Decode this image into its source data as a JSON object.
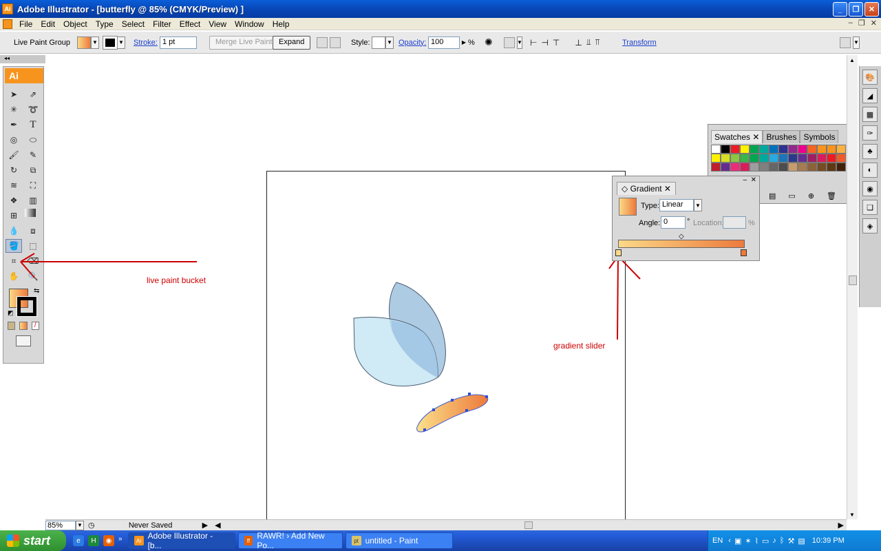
{
  "window": {
    "title": "Adobe Illustrator - [butterfly @ 85% (CMYK/Preview) ]",
    "app_icon": "Ai"
  },
  "menu": [
    "File",
    "Edit",
    "Object",
    "Type",
    "Select",
    "Filter",
    "Effect",
    "View",
    "Window",
    "Help"
  ],
  "control_bar": {
    "selection_label": "Live Paint Group",
    "stroke_label": "Stroke:",
    "stroke_value": "1 pt",
    "merge_button": "Merge Live Paint",
    "expand_button": "Expand",
    "style_label": "Style:",
    "opacity_label": "Opacity:",
    "opacity_value": "100",
    "opacity_unit": "%",
    "transform_link": "Transform"
  },
  "toolbox": {
    "logo": "Ai"
  },
  "swatches_panel": {
    "tabs": [
      "Swatches",
      "Brushes",
      "Symbols"
    ],
    "colors": [
      "#ffffff",
      "#000000",
      "#ed1c24",
      "#fff200",
      "#00a651",
      "#00a99d",
      "#0072bc",
      "#2e3192",
      "#92278f",
      "#ec008c",
      "#f26522",
      "#f7941d",
      "#f7941d",
      "#fbb040",
      "#fff200",
      "#d7df23",
      "#8dc63f",
      "#39b54a",
      "#00a651",
      "#00a99d",
      "#27aae1",
      "#1c75bc",
      "#2b388f",
      "#662d91",
      "#9e1f63",
      "#da1c5c",
      "#ed1c24",
      "#f15a29",
      "#be1e2d",
      "#662d91",
      "#ee2a7b",
      "#d91c5c",
      "#9e9e9e",
      "#808080",
      "#666666",
      "#4d4d4d",
      "#c69c6d",
      "#a67c52",
      "#8c6239",
      "#754c24",
      "#603813",
      "#42210b"
    ]
  },
  "gradient_panel": {
    "title": "Gradient",
    "type_label": "Type:",
    "type_value": "Linear",
    "angle_label": "Angle:",
    "angle_value": "0",
    "angle_unit": "°",
    "location_label": "Location:",
    "location_unit": "%",
    "start_color": "#fbd988",
    "end_color": "#ed7a3c"
  },
  "status": {
    "zoom": "85%",
    "save_state": "Never Saved"
  },
  "annotations": {
    "bucket": "live paint bucket",
    "slider": "gradient slider",
    "color": "#cc0000"
  },
  "taskbar": {
    "start": "start",
    "tasks": [
      {
        "label": "Adobe Illustrator - [b...",
        "icon": "Ai"
      },
      {
        "label": "RAWR! › Add New Po...",
        "icon": "ff"
      },
      {
        "label": "untitled - Paint",
        "icon": "pt"
      }
    ],
    "lang": "EN",
    "clock": "10:39 PM"
  }
}
